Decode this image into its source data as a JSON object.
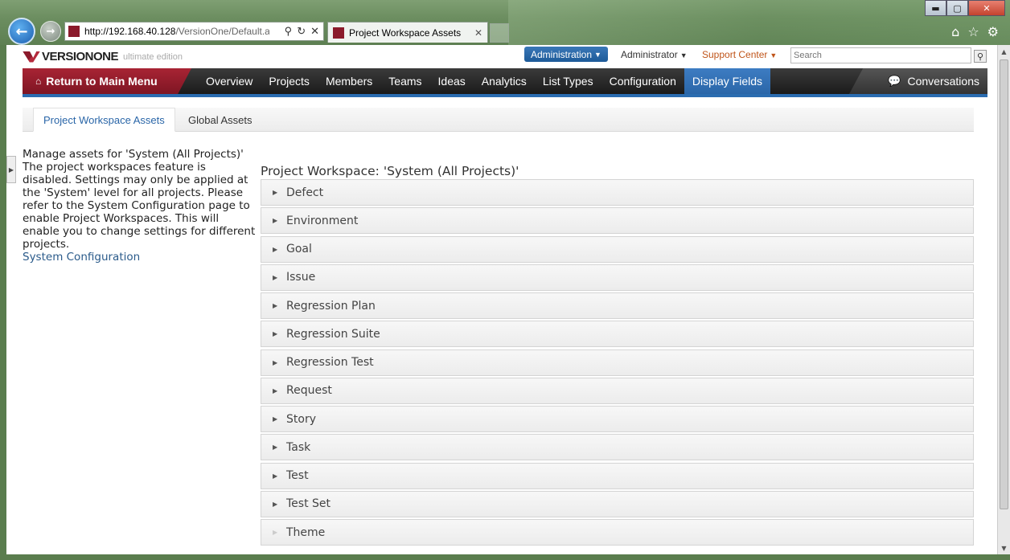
{
  "browser": {
    "url_host": "http://192.168.40.128",
    "url_path": "/VersionOne/Default.a",
    "tab_title": "Project Workspace Assets",
    "tab_close": "✕",
    "window_controls": {
      "minimize": "▬",
      "maximize": "▢",
      "close": "✕"
    }
  },
  "header": {
    "logo_text": "VERSIONONE",
    "logo_edition": "ultimate edition",
    "admin_button": "Administration",
    "user_menu": "Administrator",
    "support_menu": "Support Center",
    "search_placeholder": "Search"
  },
  "navbar": {
    "return_label": "Return to Main Menu",
    "items": [
      {
        "label": "Overview"
      },
      {
        "label": "Projects"
      },
      {
        "label": "Members"
      },
      {
        "label": "Teams"
      },
      {
        "label": "Ideas"
      },
      {
        "label": "Analytics"
      },
      {
        "label": "List Types"
      },
      {
        "label": "Configuration"
      },
      {
        "label": "Display Fields"
      }
    ],
    "conversations_label": "Conversations"
  },
  "subtabs": {
    "active": "Project Workspace Assets",
    "inactive": "Global Assets"
  },
  "left_panel": {
    "description": "Manage assets for 'System (All Projects)' The project workspaces feature is disabled. Settings may only be applied at the 'System' level for all projects. Please refer to the System Configuration page to enable Project Workspaces. This will enable you to change settings for different projects.",
    "link": "System Configuration"
  },
  "main": {
    "title": "Project Workspace: 'System (All Projects)'",
    "assets": [
      {
        "label": "Defect"
      },
      {
        "label": "Environment"
      },
      {
        "label": "Goal"
      },
      {
        "label": "Issue"
      },
      {
        "label": "Regression Plan"
      },
      {
        "label": "Regression Suite"
      },
      {
        "label": "Regression Test"
      },
      {
        "label": "Request"
      },
      {
        "label": "Story"
      },
      {
        "label": "Task"
      },
      {
        "label": "Test"
      },
      {
        "label": "Test Set"
      },
      {
        "label": "Theme"
      }
    ]
  },
  "colors": {
    "brand_red": "#8b1a2b",
    "nav_active_blue": "#2a66a8",
    "support_orange": "#c0551a",
    "link_blue": "#2a5a8a"
  }
}
